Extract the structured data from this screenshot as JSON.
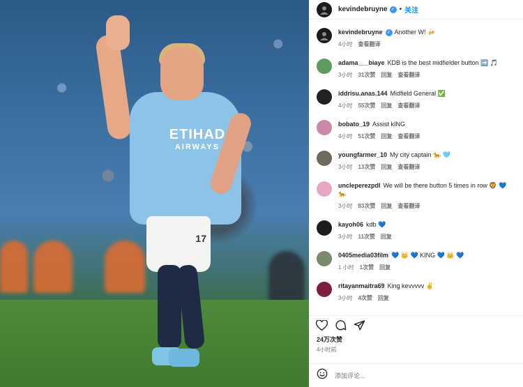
{
  "header": {
    "username": "kevindebruyne",
    "separator": "•",
    "follow_label": "关注"
  },
  "caption": {
    "username": "kevindebruyne",
    "text": "Another W! 🍻",
    "time": "4小时",
    "translate": "查看翻译"
  },
  "comments": [
    {
      "username": "adama___biaye",
      "text": "KDB is the best midfielder button ➡️ 🎵",
      "time": "3小时",
      "likes": "31次赞",
      "reply": "回复",
      "translate": "查看翻译"
    },
    {
      "username": "iddrisu.anas.144",
      "text": "Midfield General ✅",
      "time": "4小时",
      "likes": "55次赞",
      "reply": "回复",
      "translate": "查看翻译"
    },
    {
      "username": "bobato_19",
      "text": "Assist kING",
      "time": "4小时",
      "likes": "51次赞",
      "reply": "回复",
      "translate": "查看翻译"
    },
    {
      "username": "youngfarmer_10",
      "text": "My city captain 🐆 🩵",
      "time": "3小时",
      "likes": "13次赞",
      "reply": "回复",
      "translate": "查看翻译"
    },
    {
      "username": "uncleperezpdl",
      "text": "We will be there button 5 times in row 🦁 💙 🐆",
      "time": "3小时",
      "likes": "83次赞",
      "reply": "回复",
      "translate": "查看翻译"
    },
    {
      "username": "kayoh06",
      "text": "kdb 💙",
      "time": "3小时",
      "likes": "11次赞",
      "reply": "回复",
      "translate": ""
    },
    {
      "username": "0405media03film",
      "text": "💙 👑 💙 KING 💙 👑 💙",
      "time": "1 小时",
      "likes": "1次赞",
      "reply": "回复",
      "translate": ""
    },
    {
      "username": "ritayanmaitra69",
      "text": "King kevvvvv ✌️",
      "time": "3小时",
      "likes": "4次赞",
      "reply": "回复",
      "translate": ""
    }
  ],
  "footer": {
    "likes": "24万次赞",
    "posted": "4小时前",
    "comment_placeholder": "添加评论..."
  },
  "jersey": {
    "sponsor": "ETIHAD",
    "sub": "AIRWAYS",
    "number": "17"
  },
  "colors": {
    "link": "#0095f6",
    "verified": "#3897f0"
  },
  "icons": {
    "like": "heart-icon",
    "comment": "comment-bubble-icon",
    "share": "paper-plane-icon",
    "emoji": "smiley-icon"
  }
}
